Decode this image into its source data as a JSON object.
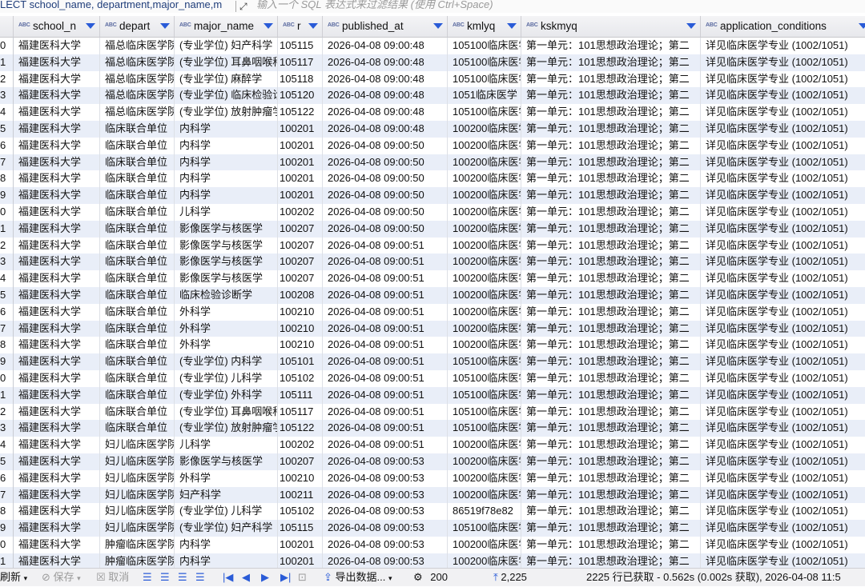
{
  "sql_bar": {
    "query_text": "LECT school_name, department,major_name,m",
    "placeholder": "输入一个 SQL 表达式来过滤结果 (使用 Ctrl+Space)"
  },
  "columns": [
    {
      "label": "school_n",
      "type_icon": "ABC"
    },
    {
      "label": "depart",
      "type_icon": "ABC"
    },
    {
      "label": "major_name",
      "type_icon": "ABC"
    },
    {
      "label": "r",
      "type_icon": "ABC"
    },
    {
      "label": "published_at",
      "type_icon": "ABC"
    },
    {
      "label": "kmlyq",
      "type_icon": "ABC"
    },
    {
      "label": "kskmyq",
      "type_icon": "ABC"
    },
    {
      "label": "application_conditions",
      "type_icon": "ABC"
    }
  ],
  "rows": [
    [
      "0",
      "福建医科大学",
      "福总临床医学院",
      "(专业学位) 妇产科学",
      "105115",
      "2026-04-08 09:00:48",
      "105100临床医学",
      "第一单元：101思想政治理论；第二",
      "详见临床医学专业 (1002/1051)"
    ],
    [
      "1",
      "福建医科大学",
      "福总临床医学院",
      "(专业学位) 耳鼻咽喉科学",
      "105117",
      "2026-04-08 09:00:48",
      "105100临床医学",
      "第一单元：101思想政治理论；第二",
      "详见临床医学专业 (1002/1051)"
    ],
    [
      "2",
      "福建医科大学",
      "福总临床医学院",
      "(专业学位) 麻醉学",
      "105118",
      "2026-04-08 09:00:48",
      "105100临床医学",
      "第一单元：101思想政治理论；第二",
      "详见临床医学专业 (1002/1051)"
    ],
    [
      "3",
      "福建医科大学",
      "福总临床医学院",
      "(专业学位) 临床检验诊断学",
      "105120",
      "2026-04-08 09:00:48",
      "1051临床医学",
      "第一单元：101思想政治理论；第二",
      "详见临床医学专业 (1002/1051)"
    ],
    [
      "4",
      "福建医科大学",
      "福总临床医学院",
      "(专业学位) 放射肿瘤学",
      "105122",
      "2026-04-08 09:00:48",
      "105100临床医学",
      "第一单元：101思想政治理论；第二",
      "详见临床医学专业 (1002/1051)"
    ],
    [
      "5",
      "福建医科大学",
      "临床联合单位",
      "内科学",
      "100201",
      "2026-04-08 09:00:48",
      "100200临床医学",
      "第一单元：101思想政治理论；第二",
      "详见临床医学专业 (1002/1051)"
    ],
    [
      "6",
      "福建医科大学",
      "临床联合单位",
      "内科学",
      "100201",
      "2026-04-08 09:00:50",
      "100200临床医学",
      "第一单元：101思想政治理论；第二",
      "详见临床医学专业 (1002/1051)"
    ],
    [
      "7",
      "福建医科大学",
      "临床联合单位",
      "内科学",
      "100201",
      "2026-04-08 09:00:50",
      "100200临床医学",
      "第一单元：101思想政治理论；第二",
      "详见临床医学专业 (1002/1051)"
    ],
    [
      "8",
      "福建医科大学",
      "临床联合单位",
      "内科学",
      "100201",
      "2026-04-08 09:00:50",
      "100200临床医学",
      "第一单元：101思想政治理论；第二",
      "详见临床医学专业 (1002/1051)"
    ],
    [
      "9",
      "福建医科大学",
      "临床联合单位",
      "内科学",
      "100201",
      "2026-04-08 09:00:50",
      "100200临床医学",
      "第一单元：101思想政治理论；第二",
      "详见临床医学专业 (1002/1051)"
    ],
    [
      "0",
      "福建医科大学",
      "临床联合单位",
      "儿科学",
      "100202",
      "2026-04-08 09:00:50",
      "100200临床医学",
      "第一单元：101思想政治理论；第二",
      "详见临床医学专业 (1002/1051)"
    ],
    [
      "1",
      "福建医科大学",
      "临床联合单位",
      "影像医学与核医学",
      "100207",
      "2026-04-08 09:00:50",
      "100200临床医学",
      "第一单元：101思想政治理论；第二",
      "详见临床医学专业 (1002/1051)"
    ],
    [
      "2",
      "福建医科大学",
      "临床联合单位",
      "影像医学与核医学",
      "100207",
      "2026-04-08 09:00:51",
      "100200临床医学",
      "第一单元：101思想政治理论；第二",
      "详见临床医学专业 (1002/1051)"
    ],
    [
      "3",
      "福建医科大学",
      "临床联合单位",
      "影像医学与核医学",
      "100207",
      "2026-04-08 09:00:51",
      "100200临床医学",
      "第一单元：101思想政治理论；第二",
      "详见临床医学专业 (1002/1051)"
    ],
    [
      "4",
      "福建医科大学",
      "临床联合单位",
      "影像医学与核医学",
      "100207",
      "2026-04-08 09:00:51",
      "100200临床医学",
      "第一单元：101思想政治理论；第二",
      "详见临床医学专业 (1002/1051)"
    ],
    [
      "5",
      "福建医科大学",
      "临床联合单位",
      "临床检验诊断学",
      "100208",
      "2026-04-08 09:00:51",
      "100200临床医学",
      "第一单元：101思想政治理论；第二",
      "详见临床医学专业 (1002/1051)"
    ],
    [
      "6",
      "福建医科大学",
      "临床联合单位",
      "外科学",
      "100210",
      "2026-04-08 09:00:51",
      "100200临床医学",
      "第一单元：101思想政治理论；第二",
      "详见临床医学专业 (1002/1051)"
    ],
    [
      "7",
      "福建医科大学",
      "临床联合单位",
      "外科学",
      "100210",
      "2026-04-08 09:00:51",
      "100200临床医学",
      "第一单元：101思想政治理论；第二",
      "详见临床医学专业 (1002/1051)"
    ],
    [
      "8",
      "福建医科大学",
      "临床联合单位",
      "外科学",
      "100210",
      "2026-04-08 09:00:51",
      "100200临床医学",
      "第一单元：101思想政治理论；第二",
      "详见临床医学专业 (1002/1051)"
    ],
    [
      "9",
      "福建医科大学",
      "临床联合单位",
      "(专业学位) 内科学",
      "105101",
      "2026-04-08 09:00:51",
      "105100临床医学",
      "第一单元：101思想政治理论；第二",
      "详见临床医学专业 (1002/1051)"
    ],
    [
      "0",
      "福建医科大学",
      "临床联合单位",
      "(专业学位) 儿科学",
      "105102",
      "2026-04-08 09:00:51",
      "105100临床医学",
      "第一单元：101思想政治理论；第二",
      "详见临床医学专业 (1002/1051)"
    ],
    [
      "1",
      "福建医科大学",
      "临床联合单位",
      "(专业学位) 外科学",
      "105111",
      "2026-04-08 09:00:51",
      "105100临床医学",
      "第一单元：101思想政治理论；第二",
      "详见临床医学专业 (1002/1051)"
    ],
    [
      "2",
      "福建医科大学",
      "临床联合单位",
      "(专业学位) 耳鼻咽喉科学",
      "105117",
      "2026-04-08 09:00:51",
      "105100临床医学",
      "第一单元：101思想政治理论；第二",
      "详见临床医学专业 (1002/1051)"
    ],
    [
      "3",
      "福建医科大学",
      "临床联合单位",
      "(专业学位) 放射肿瘤学",
      "105122",
      "2026-04-08 09:00:51",
      "105100临床医学",
      "第一单元：101思想政治理论；第二",
      "详见临床医学专业 (1002/1051)"
    ],
    [
      "4",
      "福建医科大学",
      "妇儿临床医学院",
      "儿科学",
      "100202",
      "2026-04-08 09:00:51",
      "100200临床医学",
      "第一单元：101思想政治理论；第二",
      "详见临床医学专业 (1002/1051)"
    ],
    [
      "5",
      "福建医科大学",
      "妇儿临床医学院",
      "影像医学与核医学",
      "100207",
      "2026-04-08 09:00:53",
      "100200临床医学",
      "第一单元：101思想政治理论；第二",
      "详见临床医学专业 (1002/1051)"
    ],
    [
      "6",
      "福建医科大学",
      "妇儿临床医学院",
      "外科学",
      "100210",
      "2026-04-08 09:00:53",
      "100200临床医学",
      "第一单元：101思想政治理论；第二",
      "详见临床医学专业 (1002/1051)"
    ],
    [
      "7",
      "福建医科大学",
      "妇儿临床医学院",
      "妇产科学",
      "100211",
      "2026-04-08 09:00:53",
      "100200临床医学",
      "第一单元：101思想政治理论；第二",
      "详见临床医学专业 (1002/1051)"
    ],
    [
      "8",
      "福建医科大学",
      "妇儿临床医学院",
      "(专业学位) 儿科学",
      "105102",
      "2026-04-08 09:00:53",
      "86519f78e82",
      "第一单元：101思想政治理论；第二",
      "详见临床医学专业 (1002/1051)"
    ],
    [
      "9",
      "福建医科大学",
      "妇儿临床医学院",
      "(专业学位) 妇产科学",
      "105115",
      "2026-04-08 09:00:53",
      "105100临床医学",
      "第一单元：101思想政治理论；第二",
      "详见临床医学专业 (1002/1051)"
    ],
    [
      "0",
      "福建医科大学",
      "肿瘤临床医学院",
      "内科学",
      "100201",
      "2026-04-08 09:00:53",
      "100200临床医学",
      "第一单元：101思想政治理论；第二",
      "详见临床医学专业 (1002/1051)"
    ],
    [
      "1",
      "福建医科大学",
      "肿瘤临床医学院",
      "内科学",
      "100201",
      "2026-04-08 09:00:53",
      "100200临床医学",
      "第一单元：101思想政治理论；第二",
      "详见临床医学专业 (1002/1051)"
    ]
  ],
  "toolbar": {
    "refresh_label": "刷新",
    "save_label": "保存",
    "cancel_label": "取消",
    "export_label": "导出数据...",
    "fetch_size": "200",
    "row_count": "2,225",
    "status_text": "2225 行已获取 - 0.562s (0.002s 获取), 2026-04-08 11:5"
  },
  "colors": {
    "accent": "#2a5bd7",
    "row_alt": "#e9eef8"
  }
}
